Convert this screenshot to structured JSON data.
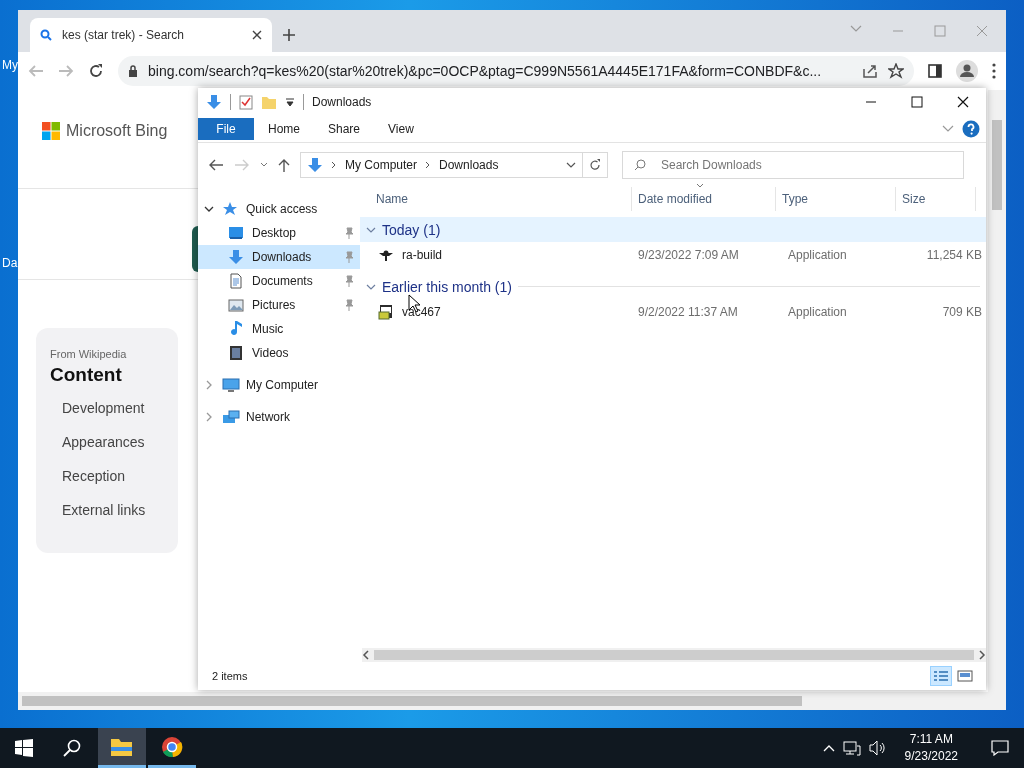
{
  "desktop_icons": [
    {
      "label": "My"
    },
    {
      "label": "Da"
    }
  ],
  "browser": {
    "tab": {
      "title": "kes (star trek) - Search",
      "selected": true
    },
    "address": "bing.com/search?q=kes%20(star%20trek)&pc=0OCP&ptag=C999N5561A4445E171FA&form=CONBDF&c...",
    "page": {
      "logo_text": "Microsoft Bing",
      "card": {
        "source": "From Wikipedia",
        "heading": "Content",
        "items": [
          "Development",
          "Appearances",
          "Reception",
          "External links"
        ]
      }
    }
  },
  "explorer": {
    "title": "Downloads",
    "ribbon_tabs": [
      {
        "label": "File",
        "kind": "menu"
      },
      {
        "label": "Home",
        "kind": "tab"
      },
      {
        "label": "Share",
        "kind": "tab"
      },
      {
        "label": "View",
        "kind": "tab"
      }
    ],
    "breadcrumb": [
      "My Computer",
      "Downloads"
    ],
    "search": {
      "placeholder": "Search Downloads"
    },
    "nav": [
      {
        "label": "Quick access",
        "kind": "star",
        "expanded": true,
        "selected": false,
        "children": [
          {
            "label": "Desktop",
            "kind": "desktop",
            "pinned": true,
            "selected": false
          },
          {
            "label": "Downloads",
            "kind": "downloads",
            "pinned": true,
            "selected": true
          },
          {
            "label": "Documents",
            "kind": "documents",
            "pinned": true,
            "selected": false
          },
          {
            "label": "Pictures",
            "kind": "pictures",
            "pinned": true,
            "selected": false
          },
          {
            "label": "Music",
            "kind": "music",
            "pinned": false,
            "selected": false
          },
          {
            "label": "Videos",
            "kind": "videos",
            "pinned": false,
            "selected": false
          }
        ]
      },
      {
        "label": "My Computer",
        "kind": "computer",
        "expanded": false,
        "selected": false
      },
      {
        "label": "Network",
        "kind": "network",
        "expanded": false,
        "selected": false
      }
    ],
    "columns": [
      "Name",
      "Date modified",
      "Type",
      "Size"
    ],
    "groups": [
      {
        "title": "Today (1)",
        "expanded": true,
        "highlighted": true,
        "files": [
          {
            "name": "ra-build",
            "kind": "app-dark",
            "date": "9/23/2022 7:09 AM",
            "type": "Application",
            "size": "11,254 KB"
          }
        ]
      },
      {
        "title": "Earlier this month (1)",
        "expanded": true,
        "highlighted": false,
        "files": [
          {
            "name": "vac467",
            "kind": "app-setup",
            "date": "9/2/2022 11:37 AM",
            "type": "Application",
            "size": "709 KB"
          }
        ]
      }
    ],
    "status": "2 items",
    "views": [
      {
        "kind": "details",
        "selected": true
      },
      {
        "kind": "thumbnails",
        "selected": false
      }
    ]
  },
  "taskbar": {
    "apps": [
      {
        "kind": "explorer",
        "active": true,
        "running": true
      },
      {
        "kind": "chrome",
        "active": false,
        "running": true
      }
    ],
    "time": "7:11 AM",
    "date": "9/23/2022"
  }
}
